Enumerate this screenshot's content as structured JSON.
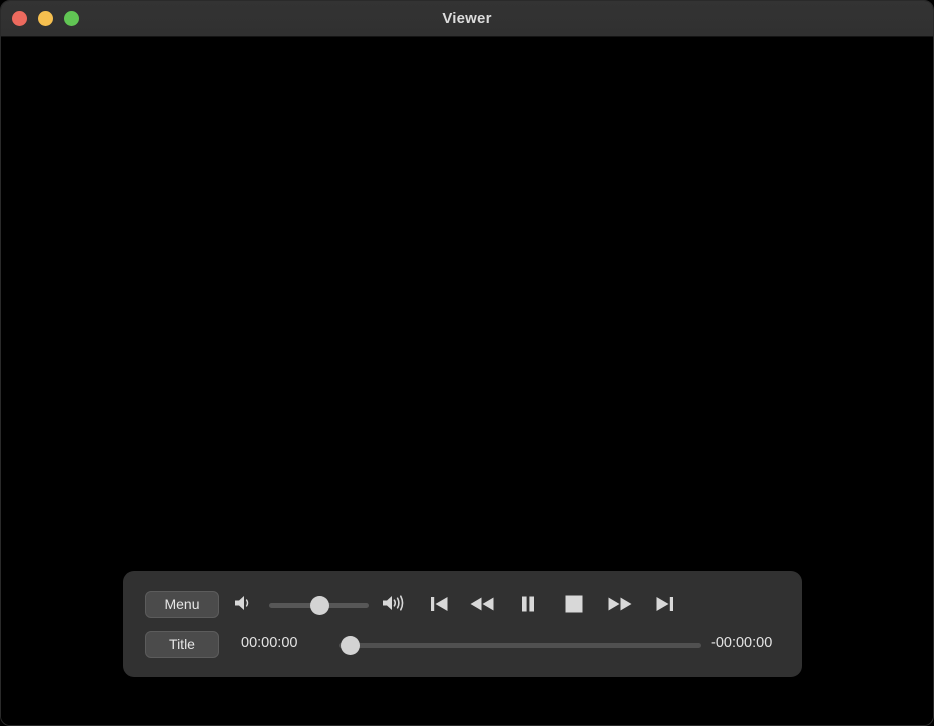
{
  "window": {
    "title": "Viewer",
    "traffic_lights": [
      {
        "name": "close",
        "color": "#ec6a5e"
      },
      {
        "name": "minimize",
        "color": "#f5bf4f"
      },
      {
        "name": "maximize",
        "color": "#61c554"
      }
    ]
  },
  "video": {
    "background_color": "#000000",
    "content": ""
  },
  "controls": {
    "background_color": "#313131",
    "menu_button_label": "Menu",
    "title_button_label": "Title",
    "volume": {
      "low_icon": "speaker-low-icon",
      "high_icon": "speaker-high-icon",
      "value_percent": 50
    },
    "transport": [
      {
        "name": "previous-chapter",
        "icon": "skip-backward-icon"
      },
      {
        "name": "rewind",
        "icon": "rewind-icon"
      },
      {
        "name": "pause",
        "icon": "pause-icon"
      },
      {
        "name": "stop",
        "icon": "stop-icon"
      },
      {
        "name": "fast-forward",
        "icon": "fast-forward-icon"
      },
      {
        "name": "next-chapter",
        "icon": "skip-forward-icon"
      }
    ],
    "timeline": {
      "elapsed": "00:00:00",
      "remaining": "-00:00:00",
      "progress_percent": 0
    }
  }
}
